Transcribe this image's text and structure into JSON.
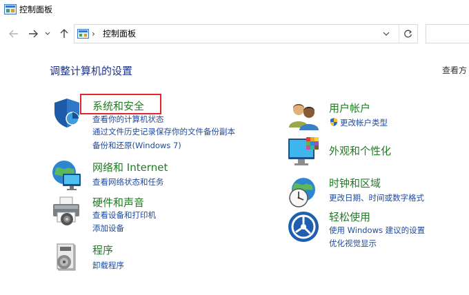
{
  "window": {
    "title": "控制面板"
  },
  "address": {
    "breadcrumb_sep": "›",
    "crumb": "控制面板"
  },
  "content": {
    "heading": "调整计算机的设置",
    "view_by": "查看方"
  },
  "categories": {
    "system_security": {
      "title": "系统和安全",
      "links": [
        "查看你的计算机状态",
        "通过文件历史记录保存你的文件备份副本",
        "备份和还原(Windows 7)"
      ]
    },
    "network": {
      "title": "网络和 Internet",
      "links": [
        "查看网络状态和任务"
      ]
    },
    "hardware": {
      "title": "硬件和声音",
      "links": [
        "查看设备和打印机",
        "添加设备"
      ]
    },
    "programs": {
      "title": "程序",
      "links": [
        "卸载程序"
      ]
    },
    "user_accounts": {
      "title": "用户帐户",
      "links": [
        "更改帐户类型"
      ]
    },
    "appearance": {
      "title": "外观和个性化",
      "links": []
    },
    "clock_region": {
      "title": "时钟和区域",
      "links": [
        "更改日期、时间或数字格式"
      ]
    },
    "ease_access": {
      "title": "轻松使用",
      "links": [
        "使用 Windows 建议的设置",
        "优化视觉显示"
      ]
    }
  },
  "colors": {
    "category_title": "#217a24",
    "link": "#1e4a9e",
    "heading": "#1e3287",
    "highlight_box": "#e0262a"
  },
  "icons": [
    "control-panel-icon",
    "back-arrow-icon",
    "forward-arrow-icon",
    "recent-dropdown-icon",
    "up-arrow-icon",
    "chevron-down-icon",
    "refresh-icon",
    "shield-icon",
    "globe-network-icon",
    "printer-icon",
    "programs-icon",
    "users-icon",
    "uac-shield-icon",
    "monitor-palette-icon",
    "clock-globe-icon",
    "ease-of-access-icon"
  ]
}
